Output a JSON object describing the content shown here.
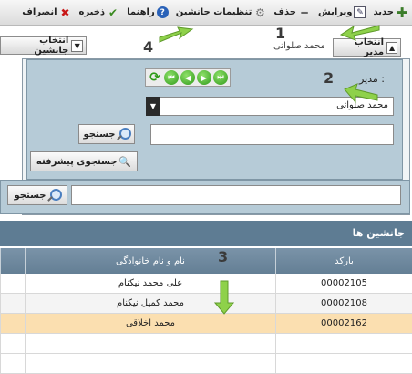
{
  "toolbar": {
    "items": [
      {
        "label": "جدید",
        "icon": "plus-icon"
      },
      {
        "label": "ویرایش",
        "icon": "edit-icon"
      },
      {
        "label": "حذف",
        "icon": "minus-icon"
      },
      {
        "label": "تنظیمات جانشین",
        "icon": "gear-icon"
      },
      {
        "label": "راهنما",
        "icon": "help-icon"
      },
      {
        "label": "ذخیره",
        "icon": "check-icon"
      },
      {
        "label": "انصراف",
        "icon": "cancel-icon"
      }
    ]
  },
  "callouts": [
    "1",
    "2",
    "3",
    "4"
  ],
  "manager_selector": {
    "button_label": "انتخاب مدیر",
    "current_value": "محمد صلواتی"
  },
  "alternate_selector": {
    "button_label": "انتخاب جانشین"
  },
  "panel": {
    "manager_label": "مدیر :",
    "selected_manager": "محمد صلواتی",
    "search_button": "جستجو",
    "advanced_search_button": "جستجوی پیشرفته"
  },
  "outer_search": {
    "search_button": "جستجو"
  },
  "grid": {
    "title": "جانشین ها",
    "columns": [
      "بارکد",
      "نام و نام خانوادگی"
    ],
    "rows": [
      {
        "barcode": "00002105",
        "name": "علی محمد نیکنام"
      },
      {
        "barcode": "00002108",
        "name": "محمد کمیل نیکنام"
      },
      {
        "barcode": "00002162",
        "name": "محمد اخلاقی"
      }
    ]
  },
  "colors": {
    "accent_arrow": "#8ed14a",
    "grid_header": "#6f889d",
    "highlight_row": "#fbdfb0"
  }
}
